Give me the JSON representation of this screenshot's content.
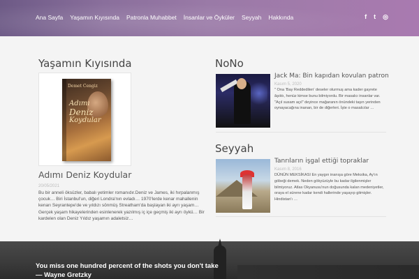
{
  "nav": {
    "items": [
      "Ana Sayfa",
      "Yaşamın Kıyısında",
      "Patronla Muhabbet",
      "İnsanlar ve Öyküler",
      "Seyyah",
      "Hakkında"
    ]
  },
  "social": {
    "facebook": "f",
    "twitter": "t",
    "instagram": "◎"
  },
  "left": {
    "section_title": "Yaşamın Kıyısında",
    "book": {
      "author": "Demet Cengiz",
      "title_line1": "Adımı",
      "title_line2": "Deniz",
      "title_line3": "Koydular"
    },
    "post_title": "Adımı Deniz Koydular",
    "date": "20/05/2021",
    "excerpt": "Bu bir anneli öksüzler, babalı yetimler romanıdır.Deniz ve James, iki hırpalanmış çocuk… Biri İstanbul'un, diğeri Londra'nın evladı… 1970'lerde kenar mahallenin kenarı Seyrantepe'de ve yıldızı sönmüş Streatham'da başlayan iki ayrı yaşam… Gerçek yaşam hikayelerinden esinlenerek yazılmış iç içe geçmiş iki ayrı öykü… Bir kardelen olan Deniz Yıldız yaşamın adaletsiz…"
  },
  "right": {
    "nono": {
      "section_title": "NoNo",
      "post_title": "Jack Ma: Bin kapıdan kovulan patron",
      "date": "Kasım 5, 2020",
      "excerpt": "\" Ona 'Bay Reddedilen' deseler olurmuş ama kader gayrete âşıktı, henüz kimse bunu bilmiyordu. Bir masalcı insanlar var. \"Açıl susam açıl\" deyince mağaranın önündeki taşın yerinden oynayacağına inanan, bir de diğerleri. İşte o masalcılar …"
    },
    "seyyah": {
      "section_title": "Seyyah",
      "post_title": "Tanrıların işgal ettiği topraklar",
      "date": "Kasım 8, 2016",
      "excerpt": "DÜNÜN MEKSİKASI En yaygın inanışa göre Meksika, Ay'ın göbeği demek. Neden gökyüzüyle bu kadar ilgilenmişler bilmiyoruz. Atlas Okyanusu'nun doğusunda kalan medeniyetler, oraya el sürene kadar kendi hallerinde yaşayıp gitmişler. Hindistan'ı …"
    }
  },
  "footer": {
    "quote_line1": "You miss one hundred percent of the shots you don't take",
    "quote_line2": "— Wayne Gretzky"
  }
}
